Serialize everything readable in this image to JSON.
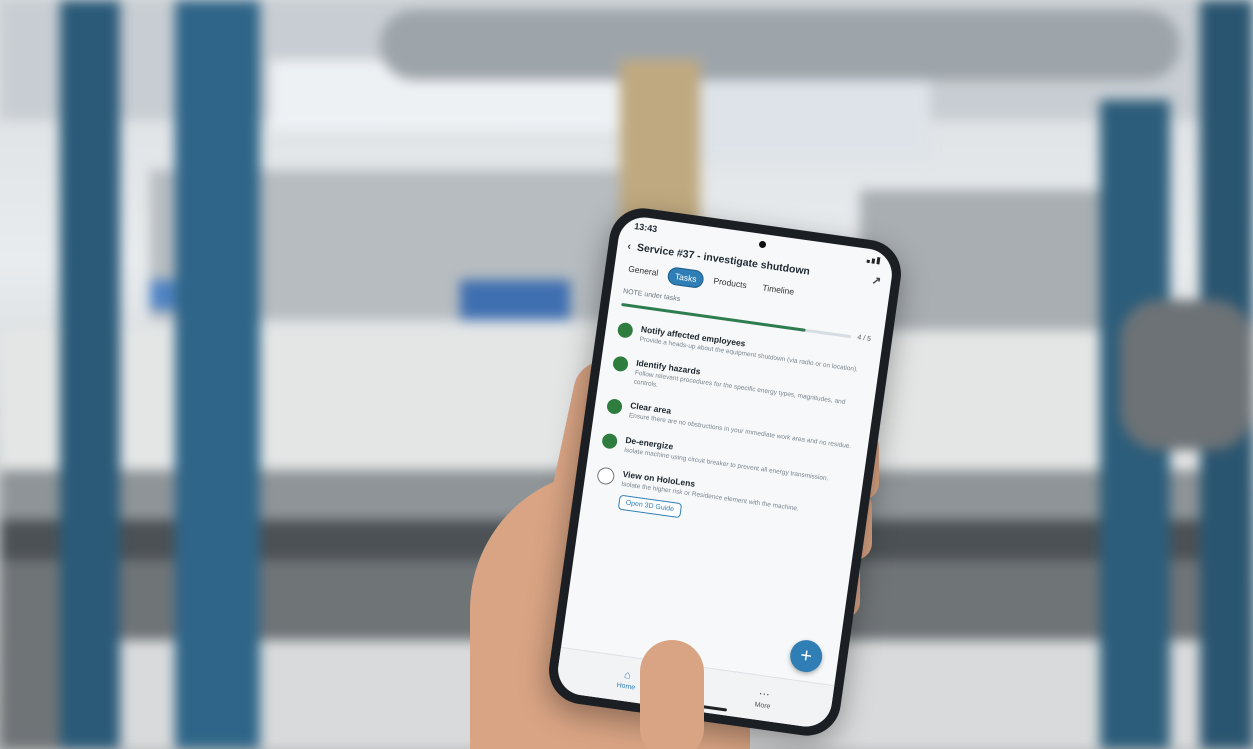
{
  "status_bar": {
    "time": "13:43"
  },
  "header": {
    "title": "Service #37 - investigate shutdown"
  },
  "tabs": [
    {
      "label": "General",
      "active": false
    },
    {
      "label": "Tasks",
      "active": true
    },
    {
      "label": "Products",
      "active": false
    },
    {
      "label": "Timeline",
      "active": false
    }
  ],
  "section_label": "NOTE under tasks",
  "progress": {
    "fraction": 0.8,
    "count_text": "4 / 5"
  },
  "tasks": [
    {
      "title": "Notify affected employees",
      "desc": "Provide a heads-up about the equipment shutdown (via radio or on location).",
      "done": true
    },
    {
      "title": "Identify hazards",
      "desc": "Follow relevant procedures for the specific energy types, magnitudes, and controls.",
      "done": true
    },
    {
      "title": "Clear area",
      "desc": "Ensure there are no obstructions in your immediate work area and no residue.",
      "done": true
    },
    {
      "title": "De-energize",
      "desc": "Isolate machine using circuit breaker to prevent all energy transmission.",
      "done": true
    },
    {
      "title": "View on HoloLens",
      "desc": "Isolate the higher risk or Residence element with the machine.",
      "done": false,
      "button_label": "Open 3D Guide"
    }
  ],
  "fab_label": "+",
  "bottom_nav": [
    {
      "label": "Home",
      "icon": "home-icon",
      "active": true
    },
    {
      "label": "More",
      "icon": "more-icon",
      "active": false
    }
  ],
  "colors": {
    "accent": "#2f7fb6",
    "done": "#2f7d3e"
  }
}
